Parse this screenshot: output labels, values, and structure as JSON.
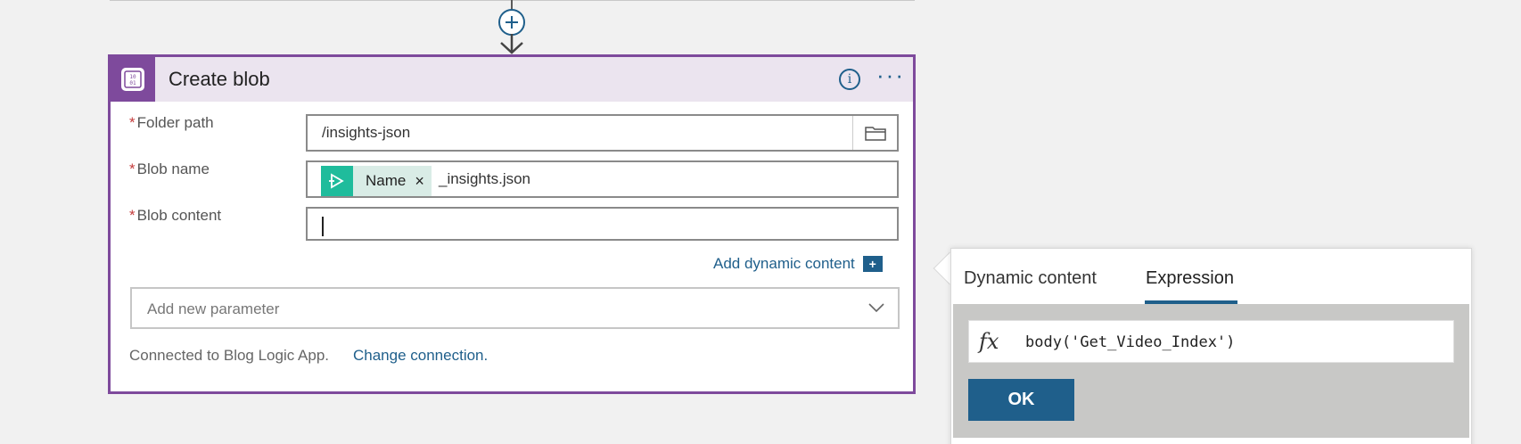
{
  "flow": {
    "add_step_icon": "plus-icon",
    "arrow_icon": "arrow-down-icon"
  },
  "card": {
    "title": "Create blob",
    "icon": "blob-storage-icon",
    "accent_color": "#7e4a9c",
    "info_label": "i",
    "more_label": "···",
    "fields": {
      "folder": {
        "required_mark": "*",
        "label": "Folder path",
        "value": "/insights-json",
        "picker_icon": "folder-icon"
      },
      "blob_name": {
        "required_mark": "*",
        "label": "Blob name",
        "token_label": "Name",
        "token_remove": "×",
        "suffix": "_insights.json"
      },
      "blob_content": {
        "required_mark": "*",
        "label": "Blob content",
        "value": ""
      }
    },
    "add_dynamic": {
      "label": "Add dynamic content",
      "icon_label": "+"
    },
    "add_parameter": {
      "placeholder": "Add new parameter"
    },
    "connection": {
      "text": "Connected to Blog Logic App.",
      "link": "Change connection."
    }
  },
  "popup": {
    "tabs": [
      {
        "label": "Dynamic content",
        "active": false
      },
      {
        "label": "Expression",
        "active": true
      }
    ],
    "fx_label": "fx",
    "expression": "body('Get_Video_Index')",
    "ok_label": "OK",
    "button_color": "#1f5f8b"
  }
}
